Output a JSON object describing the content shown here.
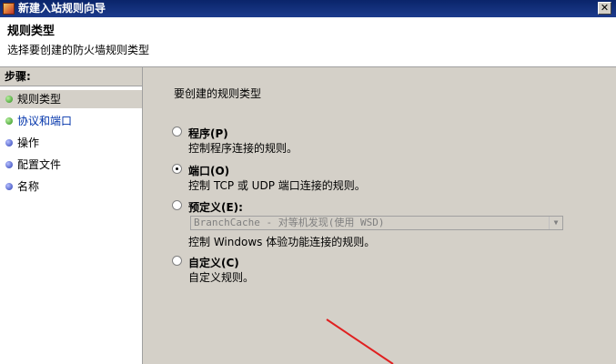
{
  "window": {
    "title": "新建入站规则向导",
    "close_label": "✕"
  },
  "header": {
    "title": "规则类型",
    "subtitle": "选择要创建的防火墙规则类型"
  },
  "sidebar": {
    "steps_label": "步骤:",
    "items": [
      {
        "label": "规则类型",
        "state": "current",
        "bullet_color": "#2c8f1a"
      },
      {
        "label": "协议和端口",
        "state": "next",
        "bullet_color": "#2c8f1a"
      },
      {
        "label": "操作",
        "state": "pending",
        "bullet_color": "#2b3fb5"
      },
      {
        "label": "配置文件",
        "state": "pending",
        "bullet_color": "#2b3fb5"
      },
      {
        "label": "名称",
        "state": "pending",
        "bullet_color": "#2b3fb5"
      }
    ]
  },
  "main": {
    "prompt": "要创建的规则类型",
    "options": [
      {
        "label": "程序(P)",
        "description": "控制程序连接的规则。",
        "selected": false
      },
      {
        "label": "端口(O)",
        "description": "控制 TCP 或 UDP 端口连接的规则。",
        "selected": true
      },
      {
        "label": "预定义(E):",
        "description": "控制 Windows 体验功能连接的规则。",
        "selected": false
      },
      {
        "label": "自定义(C)",
        "description": "自定义规则。",
        "selected": false
      }
    ],
    "predefined_combo": {
      "value": "BranchCache - 对等机发现(使用 WSD)",
      "enabled": false
    }
  }
}
